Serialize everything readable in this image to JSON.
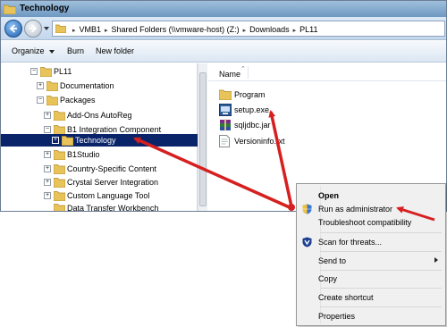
{
  "window": {
    "title": "Technology"
  },
  "address": {
    "crumbs": [
      "VMB1",
      "Shared Folders (\\\\vmware-host) (Z:)",
      "Downloads",
      "PL11"
    ]
  },
  "toolbar": {
    "organize_label": "Organize",
    "burn_label": "Burn",
    "new_folder_label": "New folder"
  },
  "tree": {
    "items": [
      {
        "label": "PL11",
        "expander": "−"
      },
      {
        "label": "Documentation",
        "expander": "+"
      },
      {
        "label": "Packages",
        "expander": "−"
      },
      {
        "label": "Add-Ons AutoReg",
        "expander": "+"
      },
      {
        "label": "B1 Integration Component",
        "expander": "−"
      },
      {
        "label": "Technology",
        "expander": "+"
      },
      {
        "label": "B1Studio",
        "expander": "+"
      },
      {
        "label": "Country-Specific Content",
        "expander": "+"
      },
      {
        "label": "Crystal Server Integration",
        "expander": "+"
      },
      {
        "label": "Custom Language Tool",
        "expander": "+"
      },
      {
        "label": "Data Transfer Workbench",
        "expander": ""
      }
    ]
  },
  "content": {
    "column_name": "Name",
    "files": [
      {
        "label": "Program",
        "icon": "folder-icon"
      },
      {
        "label": "setup.exe",
        "icon": "setup-exe-icon"
      },
      {
        "label": "sqljdbc.jar",
        "icon": "jar-archive-icon"
      },
      {
        "label": "Versioninfo.txt",
        "icon": "text-file-icon"
      }
    ]
  },
  "context_menu": {
    "items": [
      {
        "label": "Open"
      },
      {
        "label": "Run as administrator",
        "icon": "uac-shield-icon"
      },
      {
        "label": "Troubleshoot compatibility"
      },
      {
        "label": "Scan for threats...",
        "icon": "antivirus-shield-icon"
      },
      {
        "label": "Send to",
        "submenu": true
      },
      {
        "label": "Copy"
      },
      {
        "label": "Create shortcut"
      },
      {
        "label": "Properties"
      }
    ]
  },
  "colors": {
    "annotation_arrow": "#d62020",
    "selection": "#0a246a",
    "folder": "#e8c35a"
  }
}
